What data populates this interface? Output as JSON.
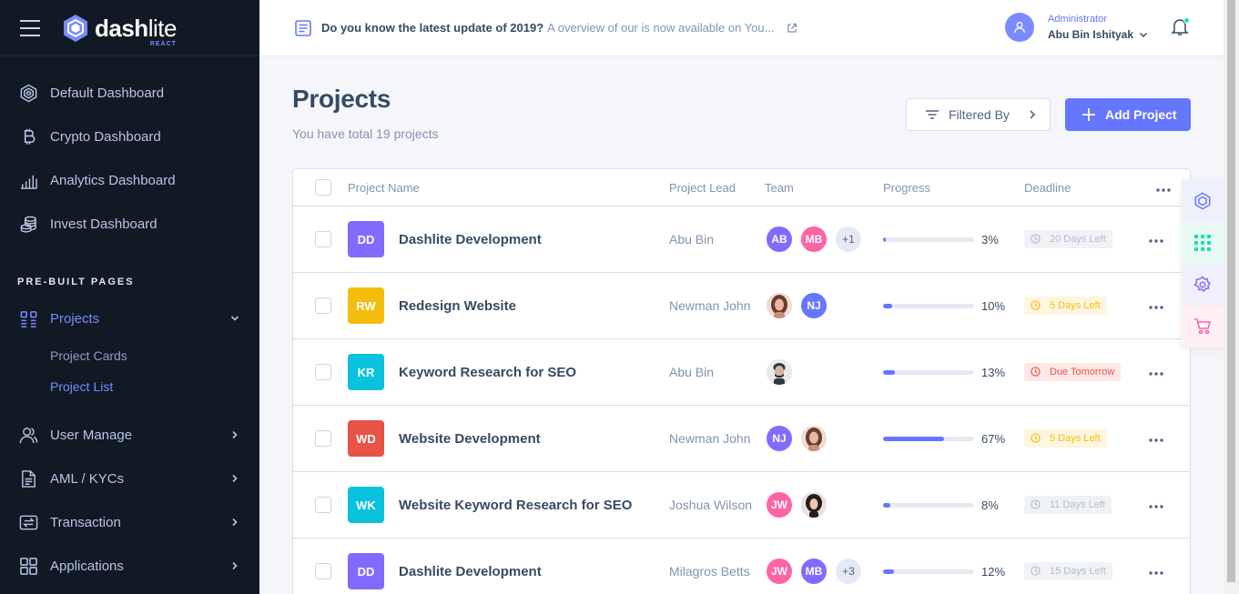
{
  "brand": {
    "name_bold": "dash",
    "name_light": "lite",
    "sub": "REACT"
  },
  "sidebar": {
    "items": [
      {
        "label": "Default Dashboard",
        "icon": "dashboard-icon"
      },
      {
        "label": "Crypto Dashboard",
        "icon": "bitcoin-icon"
      },
      {
        "label": "Analytics Dashboard",
        "icon": "analytics-icon"
      },
      {
        "label": "Invest Dashboard",
        "icon": "coins-icon"
      }
    ],
    "heading": "PRE-BUILT PAGES",
    "projects": {
      "label": "Projects",
      "sub": [
        "Project Cards",
        "Project List"
      ]
    },
    "more": [
      {
        "label": "User Manage",
        "icon": "users-icon"
      },
      {
        "label": "AML / KYCs",
        "icon": "file-text-icon"
      },
      {
        "label": "Transaction",
        "icon": "transfer-icon"
      },
      {
        "label": "Applications",
        "icon": "apps-icon"
      }
    ]
  },
  "header": {
    "news_bold": "Do you know the latest update of 2019?",
    "news_text": "A overview of our is now available on You...",
    "user_role": "Administrator",
    "user_name": "Abu Bin Ishityak"
  },
  "page": {
    "title": "Projects",
    "subtitle": "You have total 19 projects",
    "filter_label": "Filtered By",
    "add_label": "Add Project"
  },
  "table": {
    "headers": {
      "name": "Project Name",
      "lead": "Project Lead",
      "team": "Team",
      "progress": "Progress",
      "deadline": "Deadline"
    },
    "rows": [
      {
        "initials": "DD",
        "color": "#816bff",
        "name": "Dashlite Development",
        "lead": "Abu Bin",
        "team": [
          {
            "t": "AB",
            "c": "#816bff"
          },
          {
            "t": "MB",
            "c": "#ff63a5"
          },
          {
            "t": "+1",
            "c": "more"
          }
        ],
        "progress": 3,
        "progress_text": "3%",
        "deadline": "20 Days Left",
        "badge": "light"
      },
      {
        "initials": "RW",
        "color": "#f4bd0e",
        "name": "Redesign Website",
        "lead": "Newman John",
        "team": [
          {
            "t": "",
            "c": "photo"
          },
          {
            "t": "NJ",
            "c": "#6576ff"
          }
        ],
        "progress": 10,
        "progress_text": "10%",
        "deadline": "5 Days Left",
        "badge": "warn"
      },
      {
        "initials": "KR",
        "color": "#09c2de",
        "name": "Keyword Research for SEO",
        "lead": "Abu Bin",
        "team": [
          {
            "t": "",
            "c": "photo2"
          }
        ],
        "progress": 13,
        "progress_text": "13%",
        "deadline": "Due Tomorrow",
        "badge": "danger"
      },
      {
        "initials": "WD",
        "color": "#e85347",
        "name": "Website Development",
        "lead": "Newman John",
        "team": [
          {
            "t": "NJ",
            "c": "#816bff"
          },
          {
            "t": "",
            "c": "photo"
          }
        ],
        "progress": 67,
        "progress_text": "67%",
        "deadline": "5 Days Left",
        "badge": "warn"
      },
      {
        "initials": "WK",
        "color": "#09c2de",
        "name": "Website Keyword Research for SEO",
        "lead": "Joshua Wilson",
        "team": [
          {
            "t": "JW",
            "c": "#ff63a5"
          },
          {
            "t": "",
            "c": "photo3"
          }
        ],
        "progress": 8,
        "progress_text": "8%",
        "deadline": "11 Days Left",
        "badge": "light"
      },
      {
        "initials": "DD",
        "color": "#816bff",
        "name": "Dashlite Development",
        "lead": "Milagros Betts",
        "team": [
          {
            "t": "JW",
            "c": "#ff63a5"
          },
          {
            "t": "MB",
            "c": "#816bff"
          },
          {
            "t": "+3",
            "c": "more"
          }
        ],
        "progress": 12,
        "progress_text": "12%",
        "deadline": "15 Days Left",
        "badge": "light"
      }
    ]
  },
  "colors": {
    "accent": "#6576ff",
    "sidebar": "#101924"
  }
}
